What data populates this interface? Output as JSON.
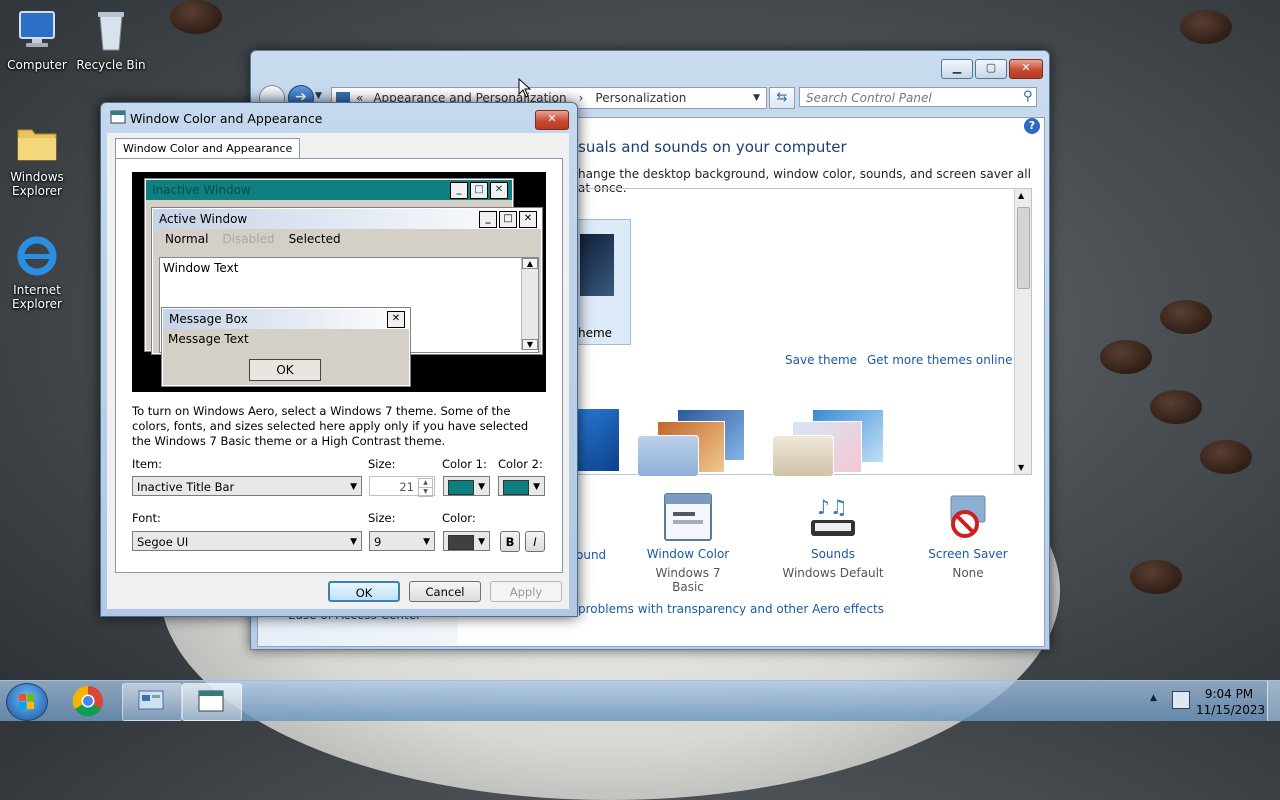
{
  "desktop": {
    "icons": [
      {
        "label": "Computer"
      },
      {
        "label": "Recycle Bin"
      },
      {
        "label": "Windows Explorer"
      },
      {
        "label": "Internet Explorer"
      }
    ]
  },
  "control_panel": {
    "breadcrumb": {
      "prefix": "«",
      "parent": "Appearance and Personalization",
      "separator": "›",
      "current": "Personalization"
    },
    "search_placeholder": "Search Control Panel",
    "heading": "suals and sounds on your computer",
    "subheading": "hange the desktop background, window color, sounds, and screen saver all at once.",
    "theme_label": "heme",
    "save_theme": "Save theme",
    "more_themes": "Get more themes online",
    "bottom_items": [
      {
        "title": "ound",
        "subtitle": ""
      },
      {
        "title": "Window Color",
        "subtitle": "Windows 7 Basic"
      },
      {
        "title": "Sounds",
        "subtitle": "Windows Default"
      },
      {
        "title": "Screen Saver",
        "subtitle": "None"
      }
    ],
    "aero_link": "problems with transparency and other Aero effects",
    "ease_link": "Ease of Access Center",
    "help_glyph": "?"
  },
  "dialog": {
    "title": "Window Color and Appearance",
    "tab": "Window Color and Appearance",
    "preview": {
      "inactive_title": "Inactive Window",
      "active_title": "Active Window",
      "menu": [
        "Normal",
        "Disabled",
        "Selected"
      ],
      "window_text": "Window Text",
      "msgbox_title": "Message Box",
      "msgbox_text": "Message Text",
      "msgbox_ok": "OK"
    },
    "info_text": "To turn on Windows Aero, select a Windows 7 theme.  Some of the colors, fonts, and sizes selected here apply only if you have selected the Windows 7 Basic theme or a High Contrast theme.",
    "item_label": "Item:",
    "item_value": "Inactive Title Bar",
    "size_label": "Size:",
    "size_value": "21",
    "color1_label": "Color 1:",
    "color2_label": "Color 2:",
    "font_label": "Font:",
    "font_value": "Segoe UI",
    "font_size_label": "Size:",
    "font_size_value": "9",
    "font_color_label": "Color:",
    "bold_label": "B",
    "italic_label": "I",
    "ok": "OK",
    "cancel": "Cancel",
    "apply": "Apply",
    "colors": {
      "color1": "#0f8080",
      "color2": "#0f8080",
      "font_color": "#404040",
      "active_title": "#0f8080"
    }
  },
  "taskbar": {
    "time": "9:04 PM",
    "date": "11/15/2023"
  }
}
